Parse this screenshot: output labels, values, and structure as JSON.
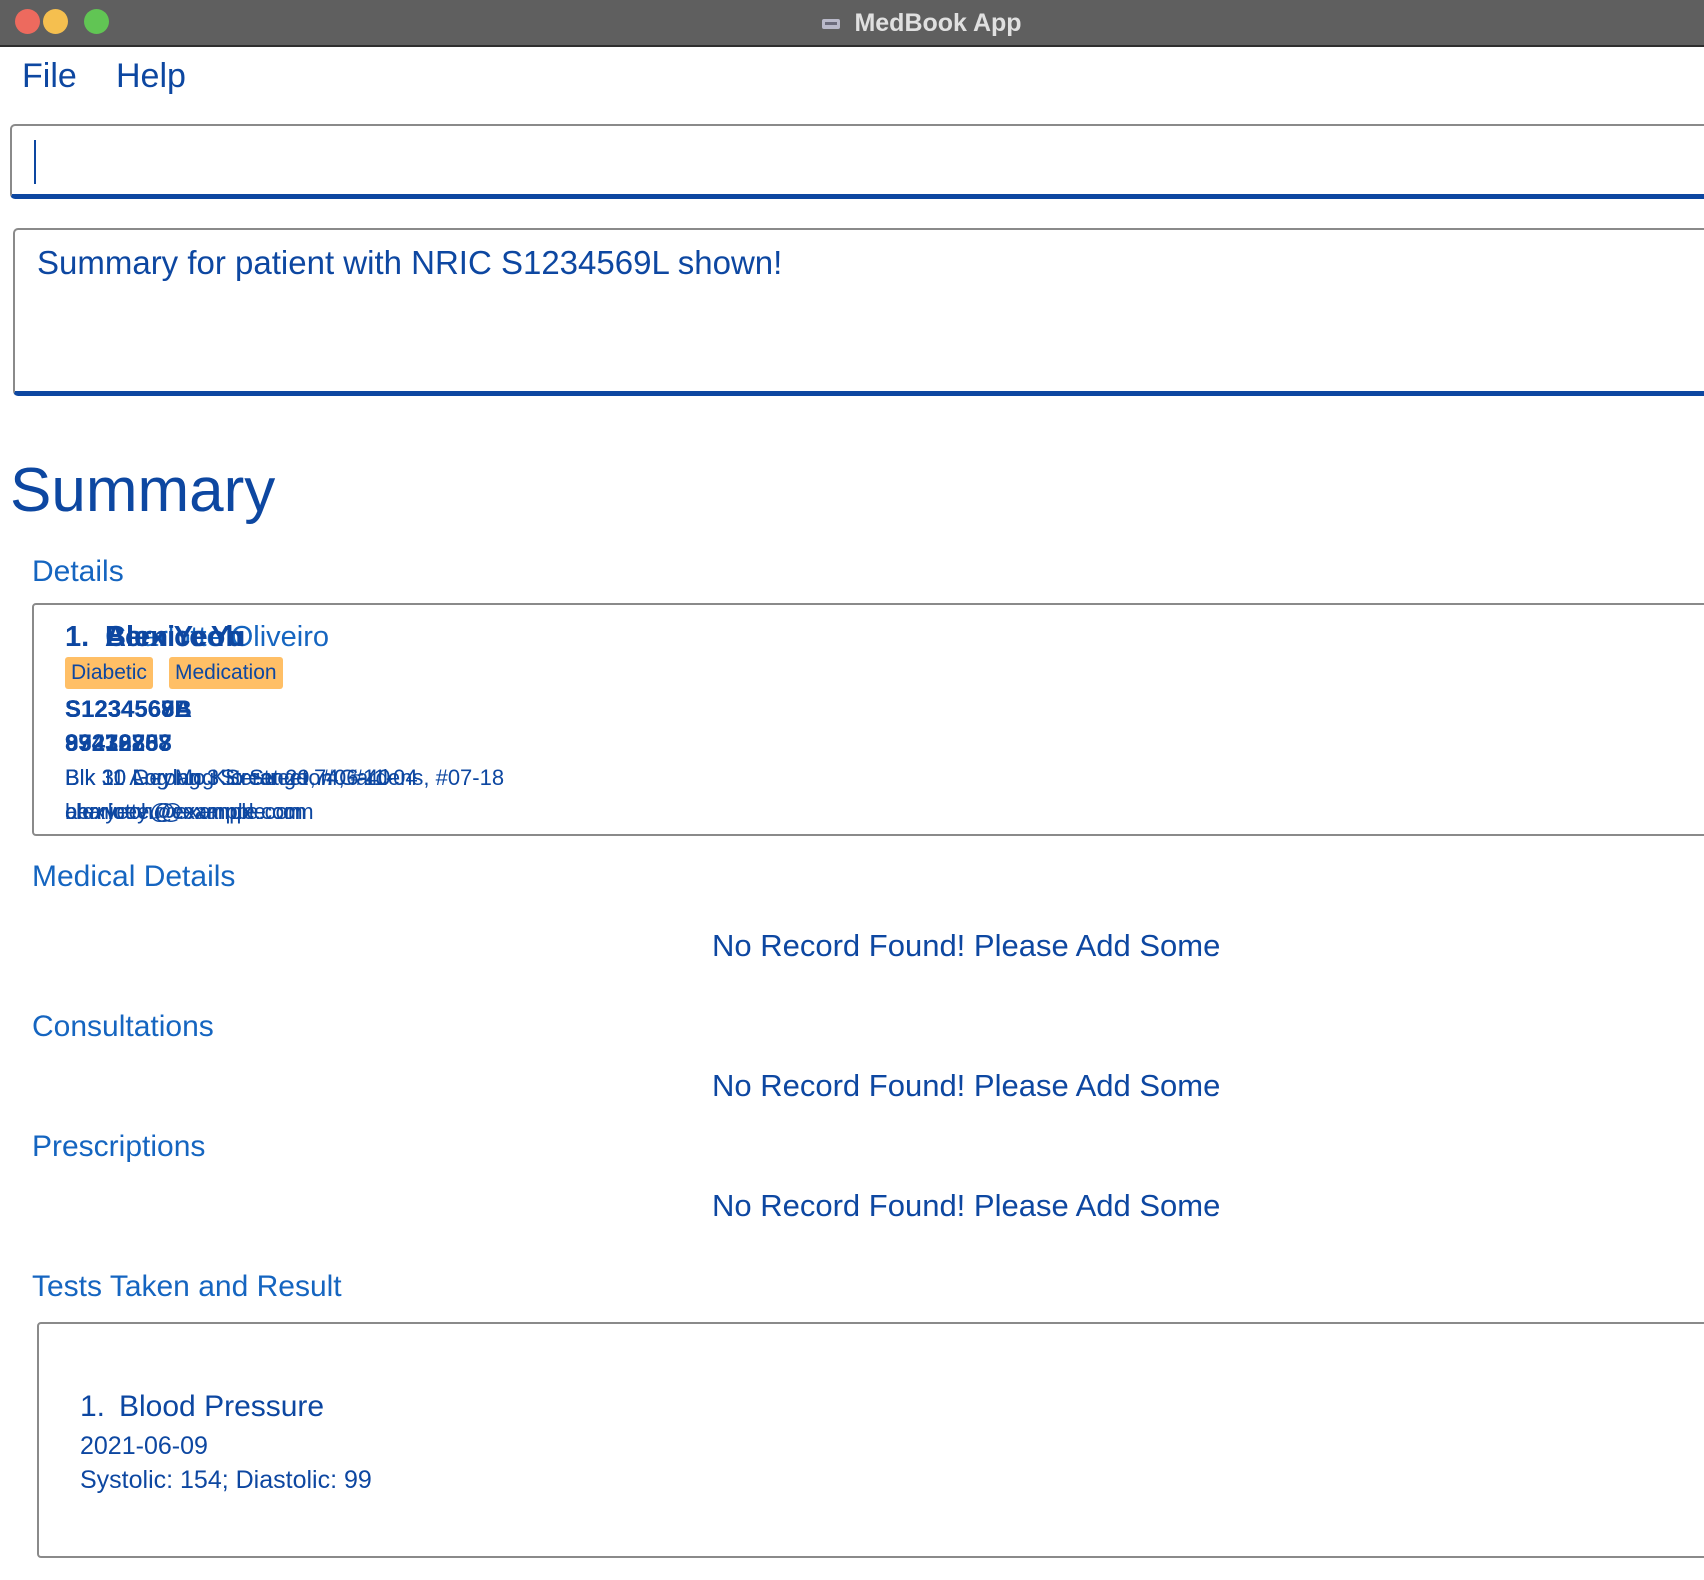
{
  "window": {
    "title": "MedBook App"
  },
  "menu": {
    "file_label": "File",
    "help_label": "Help"
  },
  "command": {
    "value": "",
    "placeholder": ""
  },
  "result": {
    "message": "Summary for patient with NRIC S1234569L shown!"
  },
  "summary": {
    "title": "Summary",
    "sections": {
      "details": "Details",
      "medical_details": "Medical Details",
      "consultations": "Consultations",
      "prescriptions": "Prescriptions",
      "tests": "Tests Taken and Result"
    },
    "details_card": {
      "index": "1.",
      "overlapping_names": [
        "Alex Yeoh",
        "Bernice Yu",
        "Charlotte Oliveiro"
      ],
      "tags": [
        "Diabetic",
        "Medication"
      ],
      "overlapping_nrics": [
        "S1234567A",
        "S1234568B",
        "S1234569L"
      ],
      "overlapping_phones": [
        "87438807",
        "99272758",
        "93210283"
      ],
      "overlapping_addresses": [
        "Blk 30 Geylang Street 29, #06-40",
        "Blk 30 Lorong 3 Serangoon Gardens, #07-18",
        "Blk 11 Ang Mo Kio Street 74, #11-04"
      ],
      "overlapping_emails": [
        "alexyeoh@example.com",
        "berniceyu@example.com",
        "charlotte@example.com"
      ]
    },
    "empty_message": "No Record Found! Please Add Some",
    "tests_card": {
      "index": "1.",
      "name": "Blood Pressure",
      "date": "2021-06-09",
      "result": "Systolic: 154; Diastolic: 99"
    }
  },
  "colors": {
    "accent": "#0d47a1",
    "tag_background": "#ffbf66",
    "titlebar": "#5f5f5f"
  }
}
